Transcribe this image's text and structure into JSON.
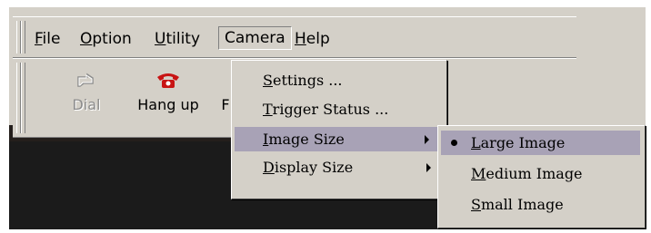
{
  "menubar": {
    "items": [
      {
        "label": "File",
        "mnemonic": "F",
        "rest": "ile"
      },
      {
        "label": "Option",
        "mnemonic": "O",
        "rest": "ption"
      },
      {
        "label": "Utility",
        "mnemonic": "U",
        "rest": "tility"
      },
      {
        "label": "Camera"
      },
      {
        "label": "Help",
        "mnemonic": "H",
        "rest": "elp"
      }
    ]
  },
  "toolbar": {
    "buttons": [
      {
        "label": "Dial",
        "icon": "dial-icon",
        "disabled": true
      },
      {
        "label": "Hang up",
        "icon": "hangup-phone-icon",
        "disabled": false
      },
      {
        "label": "F",
        "icon": "",
        "disabled": false
      }
    ]
  },
  "camera_menu": {
    "items": [
      {
        "label": "Settings ...",
        "mnemonic": "S",
        "rest": "ettings ..."
      },
      {
        "label": "Trigger Status ...",
        "mnemonic": "T",
        "rest": "rigger Status ..."
      },
      {
        "label": "Image Size",
        "mnemonic": "I",
        "rest": "mage Size",
        "has_submenu": true,
        "highlighted": true
      },
      {
        "label": "Display Size",
        "mnemonic": "D",
        "rest": "isplay Size",
        "has_submenu": true
      }
    ]
  },
  "image_size_menu": {
    "items": [
      {
        "label": "Large Image",
        "mnemonic": "L",
        "rest": "arge Image",
        "checked": true,
        "highlighted": true
      },
      {
        "label": "Medium Image",
        "mnemonic": "M",
        "rest": "edium Image"
      },
      {
        "label": "Small Image",
        "mnemonic": "S",
        "rest": "mall Image"
      }
    ]
  },
  "colors": {
    "menu_background": "#d4d0c8",
    "highlight": "#a8a2b6",
    "window_background": "#1b1b1b"
  }
}
